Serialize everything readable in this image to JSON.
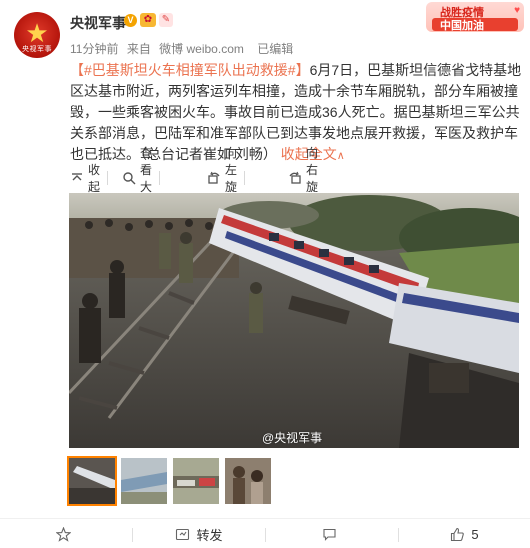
{
  "header": {
    "avatar_text": "央视军事",
    "username": "央视军事",
    "verified_mark": "V",
    "time": "11分钟前",
    "source_prefix": "来自",
    "source": "微博 weibo.com",
    "edited": "已编辑"
  },
  "banner": {
    "line1": "战胜疫情",
    "line2": "中国加油"
  },
  "post": {
    "topic": "【#巴基斯坦火车相撞军队出动救援#】",
    "text": "6月7日，巴基斯坦信德省戈特基地区达基市附近，两列客运列车相撞，造成十余节车厢脱轨，部分车厢被撞毁，一些乘客被困火车。事故目前已造成36人死亡。据巴基斯坦三军公共关系部消息，巴陆军和准军部队已到达事发地点展开救援，军医及救护车也已抵达。（总台记者崔如 刘畅）",
    "collapse": "收起全文",
    "collapse_arrow": "∧"
  },
  "toolbar": {
    "collapse": "收起",
    "view_large": "查看大图",
    "rotate_left": "向左旋转",
    "rotate_right": "向右旋转"
  },
  "image": {
    "watermark": "@央视军事"
  },
  "thumbnails": [
    "thumb-1",
    "thumb-2",
    "thumb-3",
    "thumb-4"
  ],
  "footer": {
    "favorite": "",
    "repost": "转发",
    "comment": "",
    "likes": "5"
  },
  "colors": {
    "link": "#eb7350",
    "selected_thumb": "#ff8200",
    "brand_red": "#b3140b"
  }
}
